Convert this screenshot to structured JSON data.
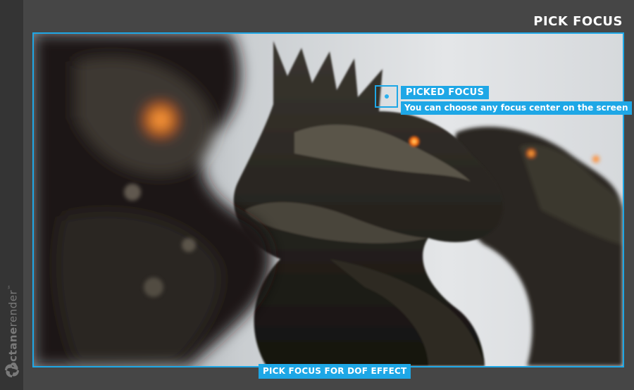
{
  "header": {
    "title": "PICK FOCUS"
  },
  "branding": {
    "product_bold": "octane",
    "product_light": "render",
    "trademark": "™"
  },
  "viewport": {
    "accent_color": "#1ea7e6",
    "scene": "render-preview",
    "focus_marker": {
      "title": "PICKED FOCUS",
      "description": "You can choose any focus center on the screen"
    }
  },
  "footer": {
    "caption": "PICK FOCUS FOR DOF EFFECT"
  }
}
